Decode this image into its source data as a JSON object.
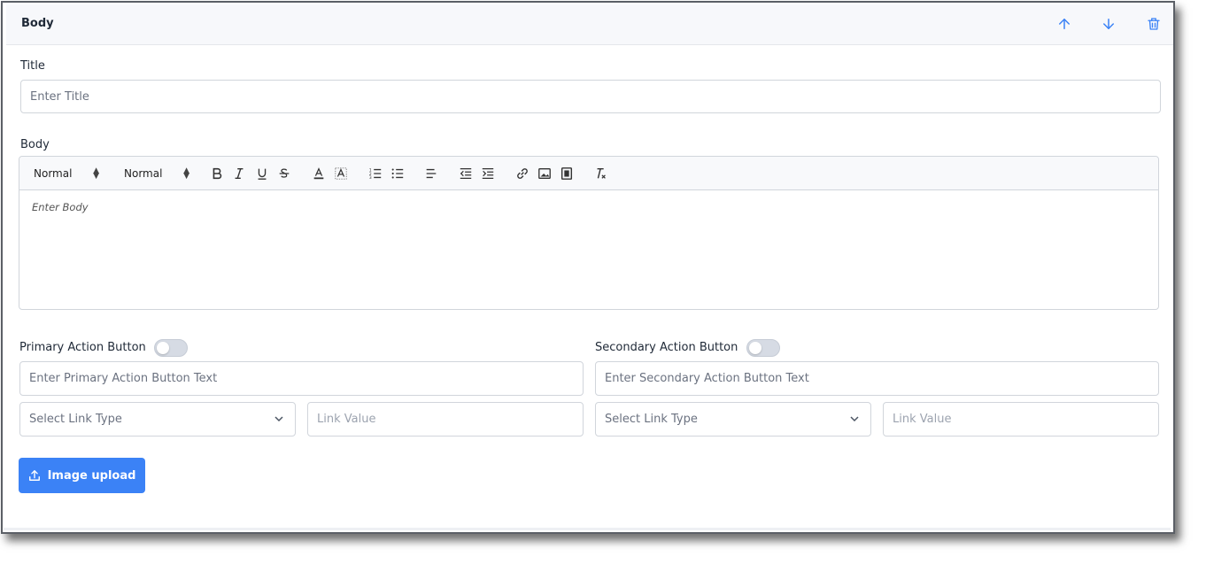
{
  "header": {
    "title": "Body",
    "icons": [
      "arrow-up-icon",
      "arrow-down-icon",
      "trash-icon"
    ],
    "accent": "#3b82f6"
  },
  "title_field": {
    "label": "Title",
    "placeholder": "Enter Title"
  },
  "body_field": {
    "label": "Body",
    "placeholder": "Enter Body",
    "toolbar": {
      "header_select": "Normal",
      "size_select": "Normal",
      "buttons": [
        "bold-icon",
        "italic-icon",
        "underline-icon",
        "strike-icon",
        "text-color-icon",
        "background-color-icon",
        "ordered-list-icon",
        "bullet-list-icon",
        "align-left-icon",
        "outdent-icon",
        "indent-icon",
        "link-icon",
        "image-icon",
        "video-icon",
        "clear-format-icon"
      ]
    }
  },
  "primary": {
    "label": "Primary Action Button",
    "text_placeholder": "Enter Primary Action Button Text",
    "link_type": "Select Link Type",
    "link_value_placeholder": "Link Value"
  },
  "secondary": {
    "label": "Secondary Action Button",
    "text_placeholder": "Enter Secondary Action Button Text",
    "link_type": "Select Link Type",
    "link_value_placeholder": "Link Value"
  },
  "upload": {
    "label": "Image upload",
    "color": "#3b82f6"
  }
}
